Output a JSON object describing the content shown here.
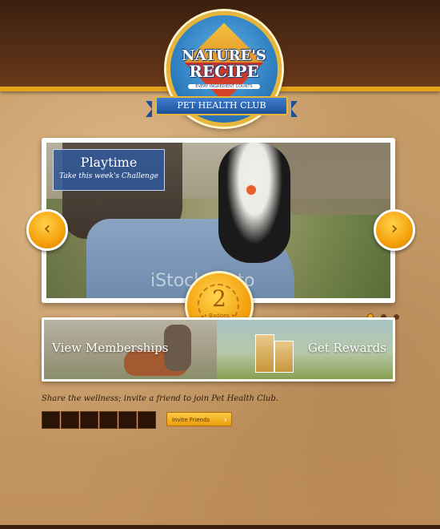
{
  "brand": {
    "name_line1": "NATURE'S",
    "name_line2": "RECIPE",
    "tagline": "EVERY INGREDIENT COUNTS",
    "club": "PET HEALTH CLUB"
  },
  "slider": {
    "caption_title": "Playtime",
    "caption_subtitle": "Take this week's Challenge",
    "watermark": "iStockphoto",
    "prev_icon": "‹",
    "next_icon": "›",
    "dots_count": 3,
    "active_dot": 0
  },
  "badges": {
    "count": "2",
    "label": "• Badges •"
  },
  "banners": {
    "memberships": "View Memberships",
    "rewards": "Get Rewards"
  },
  "share": {
    "text": "Share the wellness; invite a friend to join Pet Health Club.",
    "invite_button": "Invite Friends",
    "friend_slots": 6
  },
  "colors": {
    "accent_gold": "#f5a10c",
    "topbar_brown": "#3b1f0e",
    "caption_blue": "#305896"
  }
}
